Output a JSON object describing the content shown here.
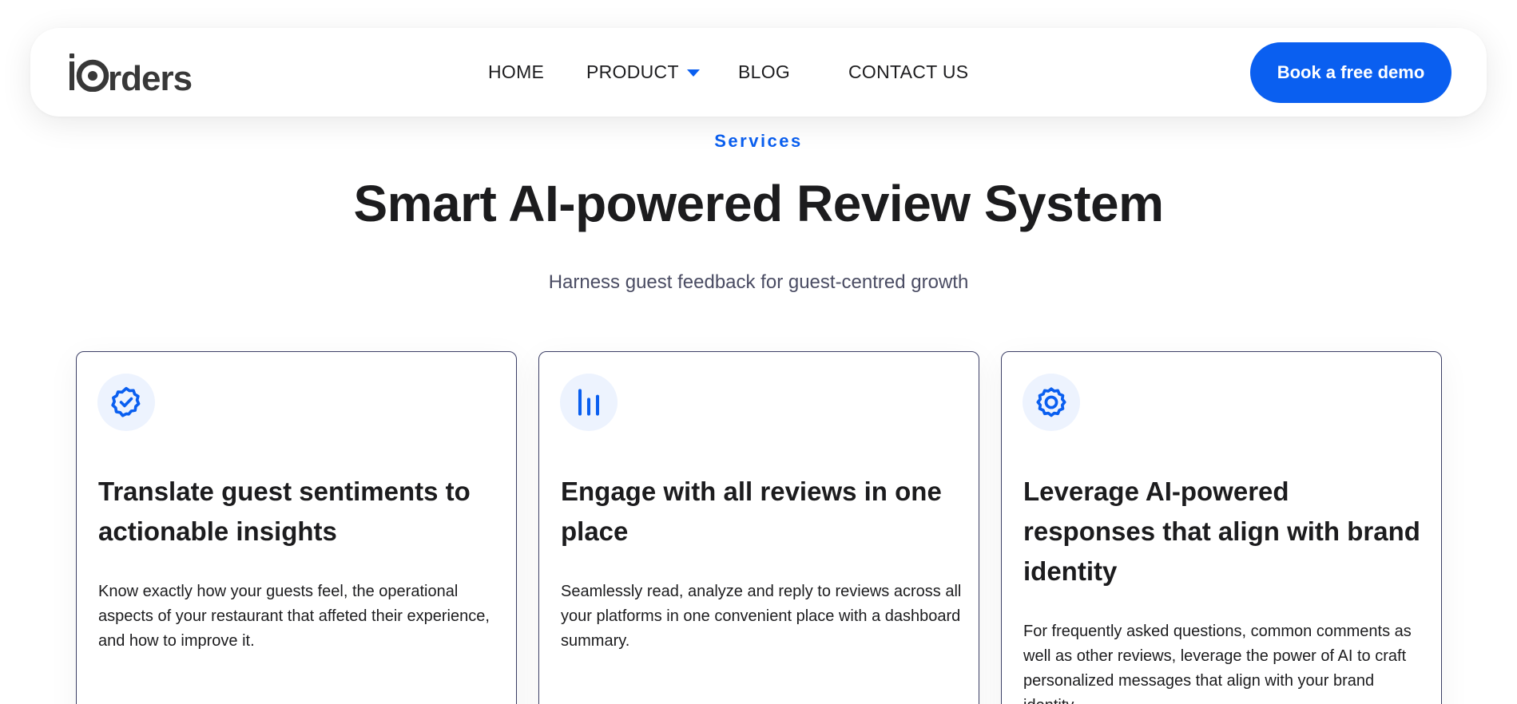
{
  "brand": {
    "logo_text": "iOrders"
  },
  "nav": {
    "items": [
      {
        "label": "HOME"
      },
      {
        "label": "PRODUCT"
      },
      {
        "label": "BLOG"
      },
      {
        "label": "CONTACT US"
      }
    ],
    "cta_label": "Book a free demo"
  },
  "hero": {
    "eyebrow": "Services",
    "title": "Smart AI-powered Review System",
    "subtitle": "Harness guest feedback for guest-centred growth"
  },
  "cards": [
    {
      "icon": "verified-badge-icon",
      "title": "Translate guest sentiments to actionable insights",
      "description": "Know exactly how your guests feel, the operational aspects of your restaurant that affeted their experience, and how to improve it."
    },
    {
      "icon": "bar-chart-icon",
      "title": "Engage with all reviews in one place",
      "description": "Seamlessly read, analyze and reply to reviews across all your platforms in one convenient place with a dashboard summary."
    },
    {
      "icon": "settings-gear-icon",
      "title": "Leverage AI-powered responses that align with brand identity",
      "description": "For frequently asked questions, common comments as well as other reviews, leverage the power of AI to craft personalized messages that align with your brand identity."
    }
  ],
  "colors": {
    "accent": "#0a5ff0",
    "icon_bg": "#edf3fe",
    "text": "#1c1c1e",
    "muted": "#4a4c63",
    "card_border": "#3c3f66"
  }
}
